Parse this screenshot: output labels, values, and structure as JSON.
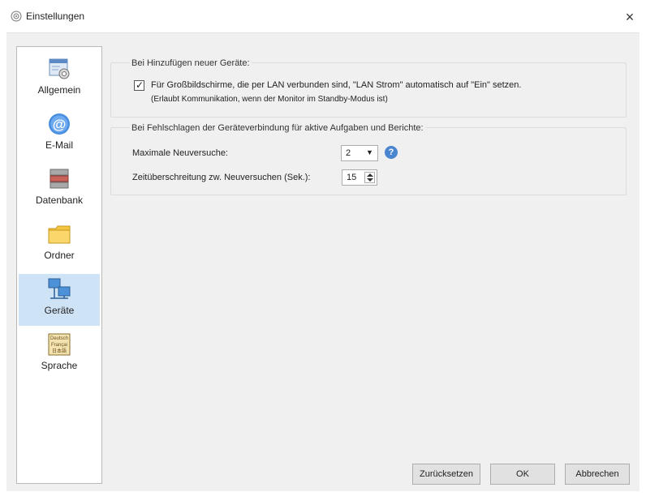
{
  "window": {
    "title": "Einstellungen",
    "close_label": "×",
    "title_icon": "gear-icon"
  },
  "sidebar": {
    "items": [
      {
        "label": "Allgemein",
        "icon": "general-settings-icon"
      },
      {
        "label": "E-Mail",
        "icon": "email-icon"
      },
      {
        "label": "Datenbank",
        "icon": "database-icon"
      },
      {
        "label": "Ordner",
        "icon": "folder-icon"
      },
      {
        "label": "Geräte",
        "icon": "devices-icon",
        "active": true
      },
      {
        "label": "Sprache",
        "icon": "language-icon"
      }
    ],
    "language_icon_text": [
      "Deutsch",
      "Françai",
      "日本語"
    ]
  },
  "group1": {
    "title": "Bei Hinzufügen neuer Geräte:",
    "checkbox_checked": true,
    "checkbox_label": "Für Großbildschirme, die per LAN verbunden sind, \"LAN Strom\" automatisch auf \"Ein\" setzen.",
    "checkbox_note": "(Erlaubt Kommunikation, wenn der Monitor im Standby-Modus ist)"
  },
  "group2": {
    "title": "Bei Fehlschlagen der Geräteverbindung für aktive Aufgaben und Berichte:",
    "retries_label": "Maximale Neuversuche:",
    "retries_value": "2",
    "help_label": "?",
    "timeout_label": "Zeitüberschreitung zw. Neuversuchen (Sek.):",
    "timeout_value": "15"
  },
  "footer": {
    "reset_label": "Zurücksetzen",
    "ok_label": "OK",
    "cancel_label": "Abbrechen"
  },
  "colors": {
    "accent": "#4a86d0",
    "active_nav": "#cfe3f6"
  }
}
